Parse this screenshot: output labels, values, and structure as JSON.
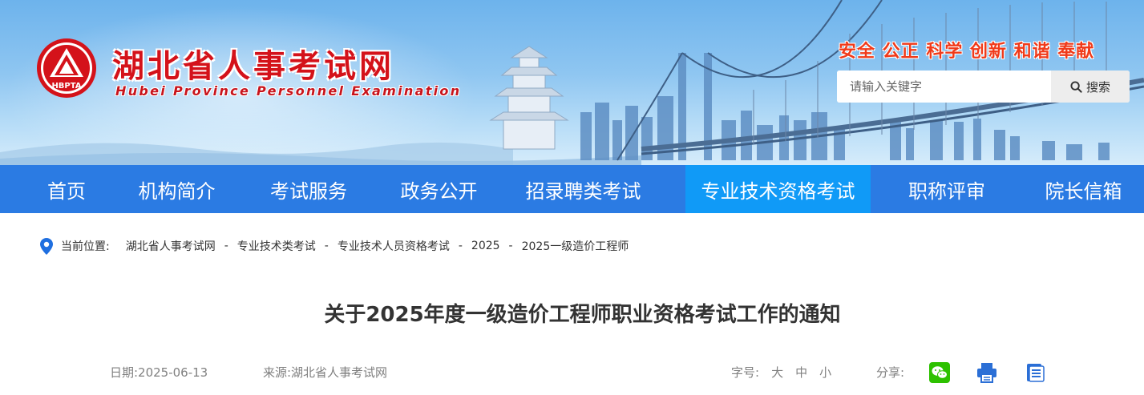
{
  "header": {
    "logo_text": "HBPTA",
    "site_title": "湖北省人事考试网",
    "site_subtitle": "Hubei Province Personnel Examination",
    "slogan": "安全 公正 科学 创新 和谐 奉献",
    "search": {
      "placeholder": "请输入关键字",
      "button_label": "搜索",
      "icon": "search-icon"
    }
  },
  "nav": {
    "items": [
      {
        "label": "首页"
      },
      {
        "label": "机构简介"
      },
      {
        "label": "考试服务"
      },
      {
        "label": "政务公开"
      },
      {
        "label": "招录聘类考试"
      },
      {
        "label": "专业技术资格考试",
        "active": true
      },
      {
        "label": "职称评审"
      },
      {
        "label": "院长信箱"
      }
    ],
    "active_index": 5
  },
  "breadcrumb": {
    "icon": "location-pin-icon",
    "label": "当前位置:",
    "items": [
      "湖北省人事考试网",
      "专业技术类考试",
      "专业技术人员资格考试",
      "2025",
      "2025一级造价工程师"
    ],
    "separator": "-"
  },
  "article": {
    "title": "关于2025年度一级造价工程师职业资格考试工作的通知",
    "date": "日期:2025-06-13",
    "source": "来源:湖北省人事考试网",
    "font_size": {
      "label": "字号:",
      "options": [
        "大",
        "中",
        "小"
      ]
    },
    "share": {
      "label": "分享:",
      "icons": [
        "wechat-icon",
        "print-icon",
        "document-icon"
      ]
    }
  },
  "colors": {
    "nav_bg": "#2b7be3",
    "nav_active_bg": "#109af7",
    "title_red": "#d4121a",
    "slogan_red": "#f03a1a",
    "breadcrumb_pin": "#1f6fe0",
    "wechat_green": "#2dc100",
    "icon_blue": "#2b6fd6"
  }
}
